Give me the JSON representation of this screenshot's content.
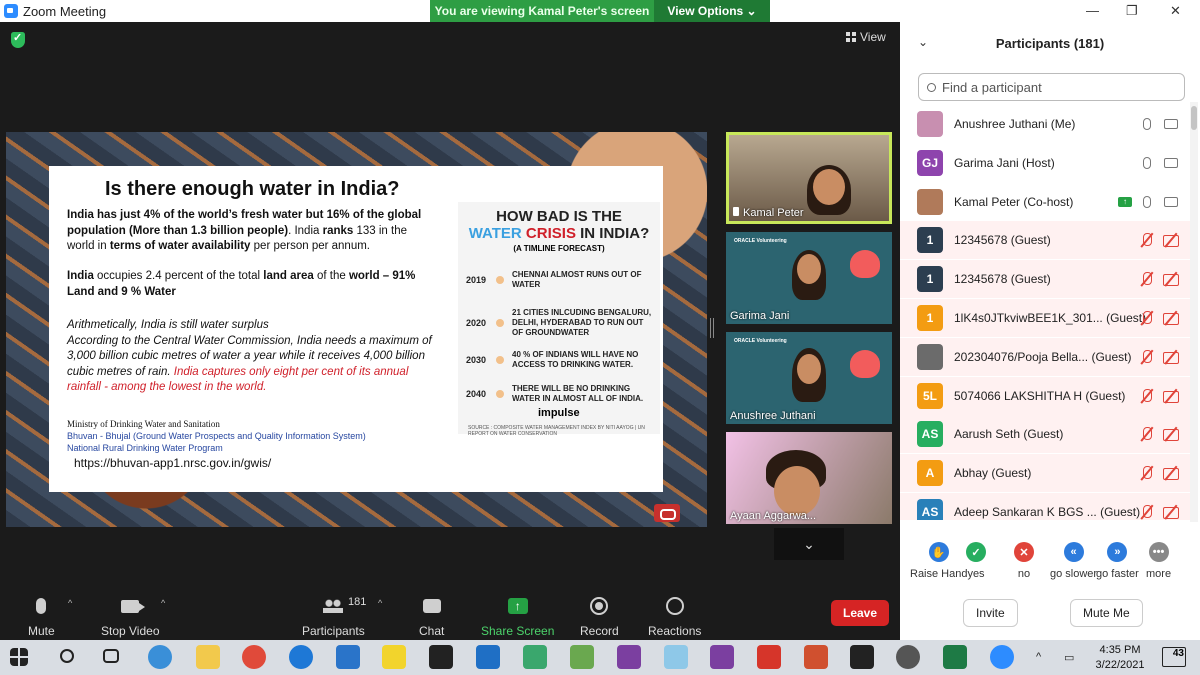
{
  "window": {
    "title": "Zoom Meeting",
    "banner": "You are viewing Kamal Peter's screen",
    "view_options": "View Options ⌄",
    "view_label": "View"
  },
  "slide": {
    "title": "Is there enough water in India?",
    "p1_parts": [
      "India has just 4% of the world’s fresh water but 16% of the global population (More than 1.3 billion people)",
      ". India ",
      "ranks",
      " 133 in the world in ",
      "terms of water availability",
      " per person per annum."
    ],
    "p2_parts": [
      "India",
      " occupies 2.4 percent of the total ",
      "land area",
      " of the ",
      "world – 91% Land and 9 % Water"
    ],
    "p3_line1": "Arithmetically, India is still water surplus",
    "p3_body": "According to the Central Water Commission, India needs a maximum of 3,000 billion cubic metres of water a year while it receives 4,000 billion cubic metres of rain.",
    "p3_red": "India captures only eight per cent of its annual rainfall - among the lowest in the world.",
    "src1": "Ministry of Drinking Water and Sanitation",
    "src2": "Bhuvan - Bhujal (Ground Water Prospects and Quality Information System)",
    "src3": "National Rural Drinking Water Program",
    "url": "https://bhuvan-app1.nrsc.gov.in/gwis/",
    "info": {
      "h1": "HOW BAD IS THE",
      "h2a": "WATER",
      "h2b": " CRISIS",
      "h2c": " IN INDIA?",
      "forecast": "(A TIMLINE FORECAST)",
      "rows": [
        {
          "year": "2019",
          "text": "CHENNAI ALMOST RUNS OUT OF WATER"
        },
        {
          "year": "2020",
          "text": "21 CITIES INLCUDING BENGALURU, DELHI, HYDERABAD TO RUN OUT OF GROUNDWATER"
        },
        {
          "year": "2030",
          "text": "40 % OF INDIANS WILL HAVE NO ACCESS TO DRINKING WATER."
        },
        {
          "year": "2040",
          "text": "THERE WILL BE NO DRINKING WATER IN ALMOST ALL OF INDIA."
        }
      ],
      "brand": "impulse",
      "footer": "SOURCE : COMPOSITE WATER MANAGEMENT INDEX BY NITI AAYOG | UN REPORT ON WATER CONSERVATION"
    }
  },
  "tiles": [
    {
      "name": "Kamal Peter"
    },
    {
      "name": "Garima Jani",
      "org": "ORACLE Volunteering"
    },
    {
      "name": "Anushree Juthani",
      "org": "ORACLE Volunteering"
    },
    {
      "name": "Ayaan Aggarwa..."
    }
  ],
  "toolbar": {
    "mute": "Mute",
    "video": "Stop Video",
    "participants": "Participants",
    "participant_count": "181",
    "chat": "Chat",
    "share": "Share Screen",
    "record": "Record",
    "reactions": "Reactions",
    "leave": "Leave"
  },
  "panel": {
    "title": "Participants (181)",
    "search_placeholder": "Find a participant",
    "participants": [
      {
        "initials": "",
        "name": "Anushree Juthani (Me)",
        "color": "#c88fb0",
        "muted": false
      },
      {
        "initials": "GJ",
        "name": "Garima Jani (Host)",
        "color": "#8e44ad",
        "muted": false
      },
      {
        "initials": "",
        "name": "Kamal Peter (Co-host)",
        "color": "#b07a5a",
        "muted": false,
        "sharing": true
      },
      {
        "initials": "1",
        "name": "12345678 (Guest)",
        "color": "#2c3e50",
        "muted": true
      },
      {
        "initials": "1",
        "name": "12345678 (Guest)",
        "color": "#2c3e50",
        "muted": true
      },
      {
        "initials": "1",
        "name": "1lK4s0JTkviwBEE1K_301... (Guest)",
        "color": "#f39c12",
        "muted": true
      },
      {
        "initials": "",
        "name": "202304076/Pooja Bella... (Guest)",
        "color": "#6b6b6b",
        "muted": true
      },
      {
        "initials": "5L",
        "name": "5074066 LAKSHITHA H (Guest)",
        "color": "#f39c12",
        "muted": true
      },
      {
        "initials": "AS",
        "name": "Aarush Seth (Guest)",
        "color": "#27ae60",
        "muted": true
      },
      {
        "initials": "A",
        "name": "Abhay (Guest)",
        "color": "#f39c12",
        "muted": true
      },
      {
        "initials": "AS",
        "name": "Adeep Sankaran K BGS ... (Guest)",
        "color": "#2980b9",
        "muted": true
      }
    ],
    "reactions": [
      {
        "label": "Raise Hand",
        "color": "#2d7bdc",
        "glyph": "✋"
      },
      {
        "label": "yes",
        "color": "#27ae60",
        "glyph": "✓"
      },
      {
        "label": "no",
        "color": "#e0443a",
        "glyph": "✕"
      },
      {
        "label": "go slower",
        "color": "#2d7bdc",
        "glyph": "«"
      },
      {
        "label": "go faster",
        "color": "#2d7bdc",
        "glyph": "»"
      },
      {
        "label": "more",
        "color": "#888888",
        "glyph": "•••"
      }
    ],
    "invite": "Invite",
    "mute_me": "Mute Me"
  },
  "taskbar": {
    "time": "4:35 PM",
    "date": "3/22/2021",
    "notifications": "43"
  }
}
